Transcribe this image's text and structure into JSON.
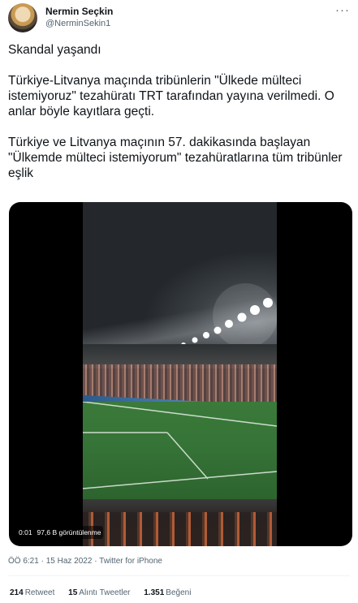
{
  "author": {
    "name": "Nermin Seçkin",
    "handle": "@NerminSekin1"
  },
  "tweet": {
    "paragraphs": [
      "Skandal yaşandı",
      "Türkiye-Litvanya maçında tribünlerin \"Ülkede mülteci istemiyoruz\" tezahüratı TRT tarafından yayına verilmedi. O anlar böyle kayıtlara geçti.",
      "Türkiye ve Litvanya maçının 57. dakikasında başlayan \"Ülkemde mülteci istemiyorum\" tezahüratlarına tüm tribünler eşlik"
    ]
  },
  "video": {
    "time": "0:01",
    "views": "97,6 B görüntülenme"
  },
  "meta": {
    "time": "ÖÖ 6:21",
    "date": "15 Haz 2022",
    "source": "Twitter for iPhone"
  },
  "stats": {
    "retweets": {
      "count": "214",
      "label": "Retweet"
    },
    "quotes": {
      "count": "15",
      "label": "Alıntı Tweetler"
    },
    "likes": {
      "count": "1.351",
      "label": "Beğeni"
    }
  },
  "icons": {
    "more": "more-horizontal-icon"
  }
}
